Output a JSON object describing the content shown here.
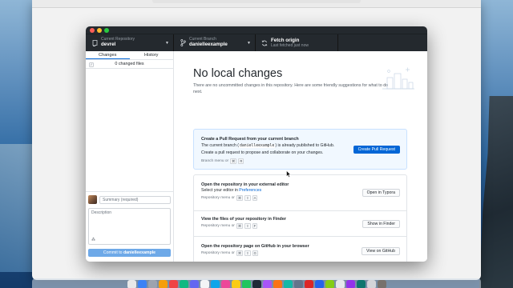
{
  "app": {
    "toolbar": {
      "repo_caption": "Current Repository",
      "repo_name": "devrel",
      "branch_caption": "Current Branch",
      "branch_name": "danielleexample",
      "fetch_title": "Fetch origin",
      "fetch_status": "Last fetched just now"
    },
    "sidebar": {
      "tabs": [
        "Changes",
        "History"
      ],
      "changed_files": "0 changed files",
      "summary_placeholder": "Summary (required)",
      "description_placeholder": "Description",
      "commit_prefix": "Commit to ",
      "commit_branch": "danielleexample"
    },
    "main": {
      "title": "No local changes",
      "description": "There are no uncommitted changes in this repository. Here are some friendly suggestions for what to do next.",
      "pull_request": {
        "title": "Create a Pull Request from your current branch",
        "line1_pre": "The current branch (",
        "line1_code": "danielleexample",
        "line1_post": ") is already published to GitHub.",
        "line2": "Create a pull request to propose and collaborate on your changes.",
        "shortcut_label": "Branch menu or",
        "keys": [
          "⌘",
          "R"
        ],
        "button": "Create Pull Request"
      },
      "editor": {
        "title": "Open the repository in your external editor",
        "text_pre": "Select your editor in ",
        "text_link": "Preferences",
        "shortcut_label": "Repository menu or",
        "keys": [
          "⌘",
          "⇧",
          "A"
        ],
        "button": "Open in Typora"
      },
      "finder": {
        "title": "View the files of your repository in Finder",
        "shortcut_label": "Repository menu or",
        "keys": [
          "⌘",
          "⇧",
          "F"
        ],
        "button": "Show in Finder"
      },
      "github": {
        "title": "Open the repository page on GitHub in your browser",
        "shortcut_label": "Repository menu or",
        "keys": [
          "⌘",
          "⇧",
          "G"
        ],
        "button": "View on GitHub"
      }
    }
  },
  "colors": {
    "toolbar_bg": "#24292e",
    "accent_blue": "#0366d6",
    "commit_button": "#6ea9e8",
    "traffic_red": "#fe5f57",
    "traffic_yellow": "#febc2e",
    "traffic_green": "#28c840"
  }
}
